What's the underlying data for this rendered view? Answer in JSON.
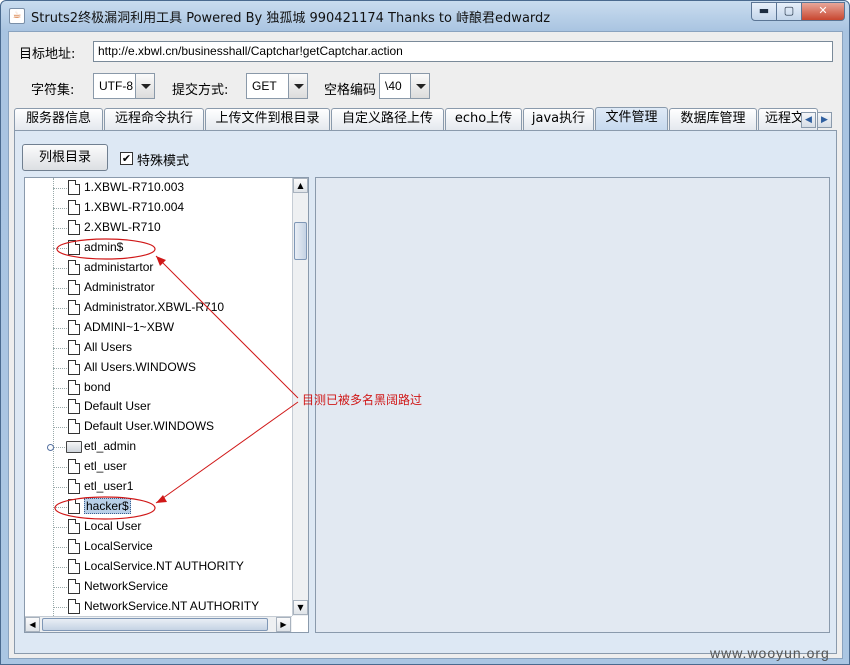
{
  "window": {
    "title": "Struts2终极漏洞利用工具   Powered By 独孤城 990421174 Thanks to 峙酿君edwardz",
    "min_glyph": "▬",
    "max_glyph": "▢",
    "close_glyph": "✕"
  },
  "target": {
    "label": "目标地址:",
    "url": "http://e.xbwl.cn/businesshall/Captchar!getCaptchar.action"
  },
  "options": {
    "charset_label": "字符集:",
    "charset_value": "UTF-8",
    "method_label": "提交方式:",
    "method_value": "GET",
    "space_label": "空格编码",
    "space_value": "\\40"
  },
  "tabs": [
    {
      "label": "服务器信息"
    },
    {
      "label": "远程命令执行"
    },
    {
      "label": "上传文件到根目录"
    },
    {
      "label": "自定义路径上传"
    },
    {
      "label": "echo上传"
    },
    {
      "label": "java执行"
    },
    {
      "label": "文件管理"
    },
    {
      "label": "数据库管理"
    },
    {
      "label": "远程文..."
    }
  ],
  "active_tab": "文件管理",
  "file_manager": {
    "list_root_label": "列根目录",
    "special_mode_label": "特殊模式",
    "special_mode_checked": "✔",
    "tree": [
      {
        "name": "1.XBWL-R710.003",
        "type": "file"
      },
      {
        "name": "1.XBWL-R710.004",
        "type": "file"
      },
      {
        "name": "2.XBWL-R710",
        "type": "file"
      },
      {
        "name": "admin$",
        "type": "file"
      },
      {
        "name": "administartor",
        "type": "file"
      },
      {
        "name": "Administrator",
        "type": "file"
      },
      {
        "name": "Administrator.XBWL-R710",
        "type": "file"
      },
      {
        "name": "ADMINI~1~XBW",
        "type": "file"
      },
      {
        "name": "All Users",
        "type": "file"
      },
      {
        "name": "All Users.WINDOWS",
        "type": "file"
      },
      {
        "name": "bond",
        "type": "file"
      },
      {
        "name": "Default User",
        "type": "file"
      },
      {
        "name": "Default User.WINDOWS",
        "type": "file"
      },
      {
        "name": "etl_admin",
        "type": "folder"
      },
      {
        "name": "etl_user",
        "type": "file"
      },
      {
        "name": "etl_user1",
        "type": "file"
      },
      {
        "name": "hacker$",
        "type": "file",
        "selected": true
      },
      {
        "name": "Local User",
        "type": "file"
      },
      {
        "name": "LocalService",
        "type": "file"
      },
      {
        "name": "LocalService.NT AUTHORITY",
        "type": "file"
      },
      {
        "name": "NetworkService",
        "type": "file"
      },
      {
        "name": "NetworkService.NT AUTHORITY",
        "type": "file"
      }
    ]
  },
  "annotation": {
    "text": "目测已被多名黑阔路过",
    "color": "#d01818"
  },
  "watermark": "www.wooyun.org"
}
